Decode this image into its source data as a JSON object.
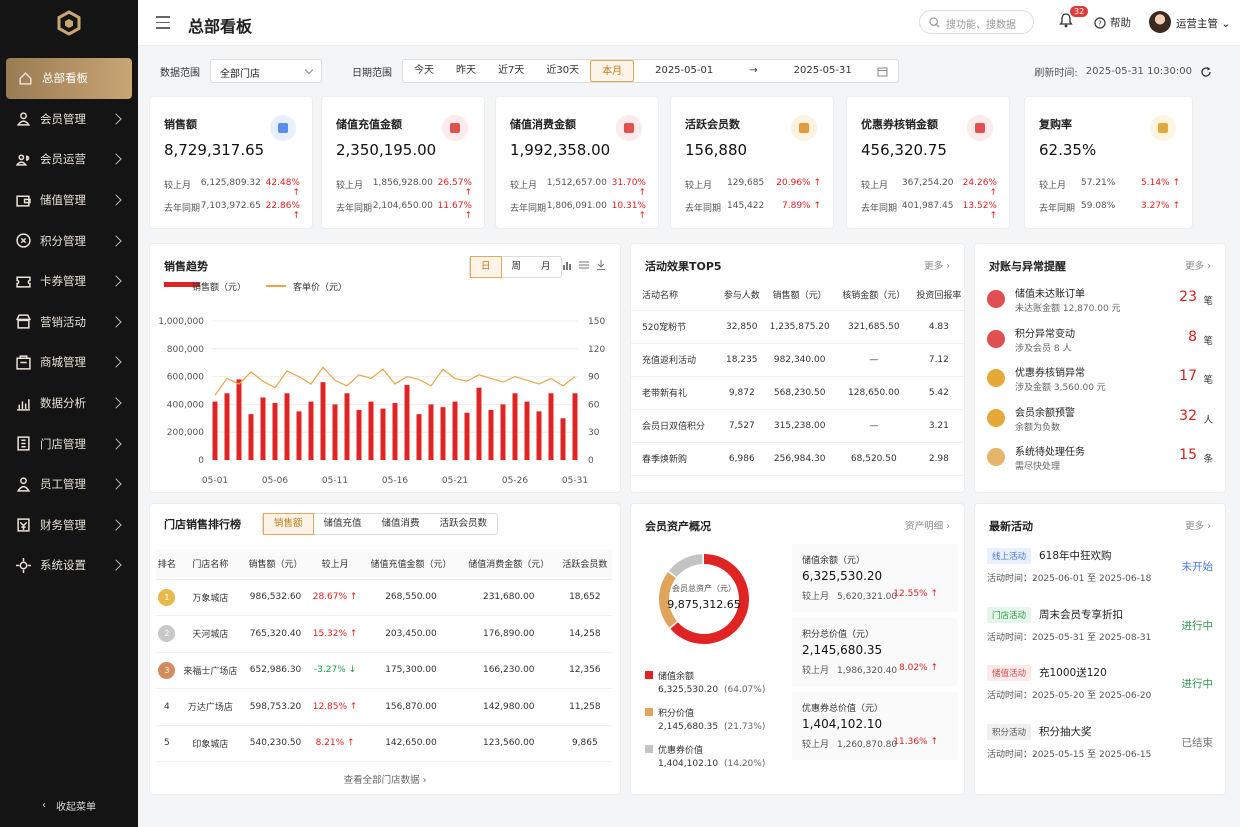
{
  "sidebar": {
    "items": [
      {
        "label": "总部看板",
        "icon": "home-icon"
      },
      {
        "label": "会员管理",
        "icon": "user-icon"
      },
      {
        "label": "会员运营",
        "icon": "user-group-icon"
      },
      {
        "label": "储值管理",
        "icon": "wallet-icon"
      },
      {
        "label": "积分管理",
        "icon": "points-icon"
      },
      {
        "label": "卡券管理",
        "icon": "ticket-icon"
      },
      {
        "label": "营销活动",
        "icon": "shop-icon"
      },
      {
        "label": "商城管理",
        "icon": "mall-icon"
      },
      {
        "label": "数据分析",
        "icon": "chart-icon"
      },
      {
        "label": "门店管理",
        "icon": "store-icon"
      },
      {
        "label": "员工管理",
        "icon": "staff-icon"
      },
      {
        "label": "财务管理",
        "icon": "finance-icon"
      },
      {
        "label": "系统设置",
        "icon": "gear-icon"
      }
    ],
    "collapse": "收起菜单"
  },
  "topbar": {
    "title": "总部看板",
    "search_placeholder": "搜功能、搜数据",
    "badge": "32",
    "help": "帮助",
    "user": "运营主管"
  },
  "filter": {
    "scope_label": "数据范围",
    "scope_value": "全部门店",
    "date_label": "日期范围",
    "ranges": [
      "今天",
      "昨天",
      "近7天",
      "近30天",
      "本月"
    ],
    "start": "2025-05-01",
    "end": "2025-05-31",
    "refresh_label": "刷新时间:",
    "refresh_time": "2025-05-31 10:30:00"
  },
  "kpis": [
    {
      "title": "销售额",
      "value": "8,729,317.65",
      "m_label": "较上月",
      "m_val": "6,125,809.32",
      "m_pct": "42.48% ↑",
      "y_label": "去年同期",
      "y_val": "7,103,972.65",
      "y_pct": "22.86% ↑",
      "color": "#5b8def",
      "bg": "#e8effd"
    },
    {
      "title": "储值充值金额",
      "value": "2,350,195.00",
      "m_label": "较上月",
      "m_val": "1,856,928.00",
      "m_pct": "26.57% ↑",
      "y_label": "去年同期",
      "y_val": "2,104,650.00",
      "y_pct": "11.67% ↑",
      "color": "#e0504f",
      "bg": "#fdeaea"
    },
    {
      "title": "储值消费金额",
      "value": "1,992,358.00",
      "m_label": "较上月",
      "m_val": "1,512,657.00",
      "m_pct": "31.70% ↑",
      "y_label": "去年同期",
      "y_val": "1,806,091.00",
      "y_pct": "10.31% ↑",
      "color": "#e0504f",
      "bg": "#fdeaea"
    },
    {
      "title": "活跃会员数",
      "value": "156,880",
      "m_label": "较上月",
      "m_val": "129,685",
      "m_pct": "20.96% ↑",
      "y_label": "去年同期",
      "y_val": "145,422",
      "y_pct": "7.89% ↑",
      "color": "#e59a3a",
      "bg": "#fdf1e2"
    },
    {
      "title": "优惠券核销金额",
      "value": "456,320.75",
      "m_label": "较上月",
      "m_val": "367,254.20",
      "m_pct": "24.26% ↑",
      "y_label": "去年同期",
      "y_val": "401,987.45",
      "y_pct": "13.52% ↑",
      "color": "#e0504f",
      "bg": "#fdeaea"
    },
    {
      "title": "复购率",
      "value": "62.35%",
      "m_label": "较上月",
      "m_val": "57.21%",
      "m_pct": "5.14% ↑",
      "y_label": "去年同期",
      "y_val": "59.08%",
      "y_pct": "3.27% ↑",
      "color": "#e5a93a",
      "bg": "#fdf4e2"
    }
  ],
  "trend": {
    "title": "销售趋势",
    "tabs": [
      "日",
      "周",
      "月"
    ],
    "legend_bar": "销售额（元）",
    "legend_line": "客单价（元）"
  },
  "chart_data": {
    "type": "bar",
    "title": "销售趋势",
    "x_ticks": [
      "05-01",
      "05-06",
      "05-11",
      "05-16",
      "05-21",
      "05-26",
      "05-31"
    ],
    "ylim": [
      0,
      1000000
    ],
    "y_ticks": [
      "1,000,000",
      "800,000",
      "600,000",
      "400,000",
      "200,000",
      "0"
    ],
    "y2lim": [
      0,
      150
    ],
    "y2_ticks": [
      "150",
      "120",
      "90",
      "60",
      "30",
      "0"
    ],
    "series": [
      {
        "name": "销售额（元）",
        "type": "bar",
        "color": "#e02424",
        "values": [
          420000,
          480000,
          580000,
          330000,
          450000,
          410000,
          480000,
          350000,
          420000,
          560000,
          400000,
          480000,
          360000,
          420000,
          370000,
          410000,
          540000,
          330000,
          400000,
          380000,
          420000,
          340000,
          520000,
          360000,
          400000,
          480000,
          420000,
          350000,
          480000,
          300000,
          480000
        ]
      },
      {
        "name": "客单价（元）",
        "type": "line",
        "color": "#e8a64a",
        "values": [
          70,
          88,
          82,
          95,
          85,
          78,
          96,
          90,
          82,
          100,
          86,
          80,
          92,
          88,
          98,
          82,
          90,
          87,
          80,
          98,
          88,
          85,
          92,
          88,
          84,
          90,
          86,
          82,
          88,
          80,
          90
        ]
      }
    ]
  },
  "top5": {
    "title": "活动效果TOP5",
    "more": "更多",
    "cols": [
      "活动名称",
      "参与人数",
      "销售额（元）",
      "核销金额（元）",
      "投资回报率"
    ],
    "rows": [
      [
        "520宠粉节",
        "32,850",
        "1,235,875.20",
        "321,685.50",
        "4.83"
      ],
      [
        "充值返利活动",
        "18,235",
        "982,340.00",
        "—",
        "7.12"
      ],
      [
        "老带新有礼",
        "9,872",
        "568,230.50",
        "128,650.00",
        "5.42"
      ],
      [
        "会员日双倍积分",
        "7,527",
        "315,238.00",
        "—",
        "3.21"
      ],
      [
        "春季焕新购",
        "6,986",
        "256,984.30",
        "68,520.50",
        "2.98"
      ]
    ]
  },
  "alerts": {
    "title": "对账与异常提醒",
    "more": "更多",
    "items": [
      {
        "main": "储值未达账订单",
        "sub": "未达账金额 12,870.00 元",
        "num": "23",
        "unit": "笔",
        "color": "#e05050"
      },
      {
        "main": "积分异常变动",
        "sub": "涉及会员 8 人",
        "num": "8",
        "unit": "笔",
        "color": "#e05050"
      },
      {
        "main": "优惠券核销异常",
        "sub": "涉及金额 3,560.00 元",
        "num": "17",
        "unit": "笔",
        "color": "#e5a93a"
      },
      {
        "main": "会员余额预警",
        "sub": "余额为负数",
        "num": "32",
        "unit": "人",
        "color": "#e5a93a"
      },
      {
        "main": "系统待处理任务",
        "sub": "需尽快处理",
        "num": "15",
        "unit": "条",
        "color": "#e5b56a"
      }
    ]
  },
  "rank": {
    "title": "门店销售排行榜",
    "tabs": [
      "销售额",
      "储值充值",
      "储值消费",
      "活跃会员数"
    ],
    "cols": [
      "排名",
      "门店名称",
      "销售额（元）",
      "较上月",
      "储值充值金额（元）",
      "储值消费金额（元）",
      "活跃会员数"
    ],
    "rows": [
      [
        "1",
        "万象城店",
        "986,532.60",
        "28.67% ↑",
        "268,550.00",
        "231,680.00",
        "18,652"
      ],
      [
        "2",
        "天河城店",
        "765,320.40",
        "15.32% ↑",
        "203,450.00",
        "176,890.00",
        "14,258"
      ],
      [
        "3",
        "来福士广场店",
        "652,986.30",
        "-3.27% ↓",
        "175,300.00",
        "166,230.00",
        "12,356"
      ],
      [
        "4",
        "万达广场店",
        "598,753.20",
        "12.85% ↑",
        "156,870.00",
        "142,980.00",
        "11,258"
      ],
      [
        "5",
        "印象城店",
        "540,230.50",
        "8.21% ↑",
        "142,650.00",
        "123,560.00",
        "9,865"
      ]
    ],
    "footer": "查看全部门店数据"
  },
  "assets": {
    "title": "会员资产概况",
    "more": "资产明细",
    "center_label": "会员总资产（元）",
    "center_value": "9,875,312.65",
    "legend": [
      {
        "name": "储值余额",
        "value": "6,325,530.20",
        "pct": "(64.07%)",
        "color": "#e02424",
        "share": 0.6407
      },
      {
        "name": "积分价值",
        "value": "2,145,680.35",
        "pct": "(21.73%)",
        "color": "#e0a55a",
        "share": 0.2173
      },
      {
        "name": "优惠券价值",
        "value": "1,404,102.10",
        "pct": "(14.20%)",
        "color": "#c4c4c4",
        "share": 0.142
      }
    ],
    "boxes": [
      {
        "title": "储值余额（元）",
        "value": "6,325,530.20",
        "cmp": "较上月",
        "cmp_val": "5,620,321.00",
        "pct": "12.55% ↑"
      },
      {
        "title": "积分总价值（元）",
        "value": "2,145,680.35",
        "cmp": "较上月",
        "cmp_val": "1,986,320.40",
        "pct": "8.02% ↑"
      },
      {
        "title": "优惠券总价值（元）",
        "value": "1,404,102.10",
        "cmp": "较上月",
        "cmp_val": "1,260,870.80",
        "pct": "11.36% ↑"
      }
    ]
  },
  "activities": {
    "title": "最新活动",
    "more": "更多",
    "items": [
      {
        "tag": "线上活动",
        "name": "618年中狂欢购",
        "time": "活动时间：2025-06-01 至 2025-06-18",
        "status": "未开始",
        "tag_bg": "#e8effd",
        "tag_color": "#4a7be0",
        "st_color": "#4a7be0"
      },
      {
        "tag": "门店活动",
        "name": "周末会员专享折扣",
        "time": "活动时间：2025-05-31 至 2025-08-31",
        "status": "进行中",
        "tag_bg": "#e7f6ea",
        "tag_color": "#2e9a4a",
        "st_color": "#2e9a4a"
      },
      {
        "tag": "储值活动",
        "name": "充1000送120",
        "time": "活动时间：2025-05-20 至 2025-06-20",
        "status": "进行中",
        "tag_bg": "#fdeaea",
        "tag_color": "#d44a4a",
        "st_color": "#2e9a4a"
      },
      {
        "tag": "积分活动",
        "name": "积分抽大奖",
        "time": "活动时间：2025-05-15 至 2025-06-15",
        "status": "已结束",
        "tag_bg": "#efefef",
        "tag_color": "#555",
        "st_color": "#777"
      }
    ]
  }
}
